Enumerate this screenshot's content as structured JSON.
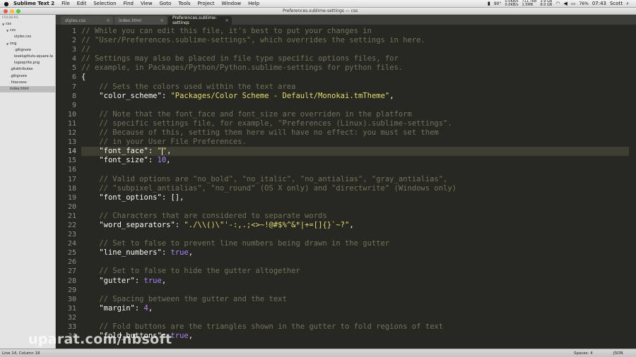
{
  "menubar": {
    "app_name": "Sublime Text 2",
    "items": [
      "File",
      "Edit",
      "Selection",
      "Find",
      "View",
      "Goto",
      "Tools",
      "Project",
      "Window",
      "Help"
    ],
    "tray": {
      "net_up": "0.0KB/s",
      "net_down": "0.0KB/s",
      "mem_a": "711.7KB",
      "mem_b": "1.5MB",
      "disk_a": "3.9 GB",
      "disk_b": "8.0 GB",
      "temp": "90°",
      "battery": "76%",
      "time": "07:43",
      "user": "Scott"
    }
  },
  "window": {
    "title": "Preferences.sublime-settings — css"
  },
  "tabs": [
    {
      "label": "styles.css",
      "active": false
    },
    {
      "label": "index.html",
      "active": false
    },
    {
      "label": "Preferences.sublime-settings",
      "active": true
    }
  ],
  "sidebar": {
    "header": "FOLDERS",
    "items": [
      {
        "label": "css",
        "indent": 0,
        "arrow": "▼",
        "selected": false
      },
      {
        "label": "css",
        "indent": 1,
        "arrow": "▼",
        "selected": false
      },
      {
        "label": "styles.css",
        "indent": 2,
        "arrow": "",
        "selected": false
      },
      {
        "label": "img",
        "indent": 1,
        "arrow": "▼",
        "selected": false
      },
      {
        "label": ".gitignore",
        "indent": 2,
        "arrow": "",
        "selected": false
      },
      {
        "label": "levelupttuts-square-la",
        "indent": 2,
        "arrow": "",
        "selected": false
      },
      {
        "label": "logosprite.png",
        "indent": 2,
        "arrow": "",
        "selected": false
      },
      {
        "label": ".gitattributes",
        "indent": 1,
        "arrow": "",
        "selected": false
      },
      {
        "label": ".gitignore",
        "indent": 1,
        "arrow": "",
        "selected": false
      },
      {
        "label": ".htaccess",
        "indent": 1,
        "arrow": "",
        "selected": false
      },
      {
        "label": "index.html",
        "indent": 1,
        "arrow": "",
        "selected": true
      }
    ]
  },
  "editor": {
    "active_line": 14,
    "lines": [
      {
        "n": "1",
        "text": "// While you can edit this file, it's best to put your changes in"
      },
      {
        "n": "2",
        "text": "// \"User/Preferences.sublime-settings\", which overrides the settings in here."
      },
      {
        "n": "3",
        "text": "//"
      },
      {
        "n": "4",
        "text": "// Settings may also be placed in file type specific options files, for"
      },
      {
        "n": "5",
        "text": "// example, in Packages/Python/Python.sublime-settings for python files."
      },
      {
        "n": "6",
        "text": "{"
      },
      {
        "n": "7",
        "text": "    // Sets the colors used within the text area"
      },
      {
        "n": "8",
        "text": "    \"color_scheme\": \"Packages/Color Scheme - Default/Monokai.tmTheme\","
      },
      {
        "n": "9",
        "text": ""
      },
      {
        "n": "10",
        "text": "    // Note that the font_face and font_size are overriden in the platform"
      },
      {
        "n": "11",
        "text": "    // specific settings file, for example, \"Preferences (Linux).sublime-settings\"."
      },
      {
        "n": "12",
        "text": "    // Because of this, setting them here will have no effect: you must set them"
      },
      {
        "n": "13",
        "text": "    // in your User File Preferences."
      },
      {
        "n": "14",
        "text": "    \"font_face\": \"\","
      },
      {
        "n": "15",
        "text": "    \"font_size\": 10,"
      },
      {
        "n": "16",
        "text": ""
      },
      {
        "n": "17",
        "text": "    // Valid options are \"no_bold\", \"no_italic\", \"no_antialias\", \"gray_antialias\","
      },
      {
        "n": "18",
        "text": "    // \"subpixel_antialias\", \"no_round\" (OS X only) and \"directwrite\" (Windows only)"
      },
      {
        "n": "19",
        "text": "    \"font_options\": [],"
      },
      {
        "n": "20",
        "text": ""
      },
      {
        "n": "21",
        "text": "    // Characters that are considered to separate words"
      },
      {
        "n": "22",
        "text": "    \"word_separators\": \"./\\\\()\\\"'-:,.;<>~!@#$%^&*|+=[]{}`~?\","
      },
      {
        "n": "23",
        "text": ""
      },
      {
        "n": "24",
        "text": "    // Set to false to prevent line numbers being drawn in the gutter"
      },
      {
        "n": "25",
        "text": "    \"line_numbers\": true,"
      },
      {
        "n": "26",
        "text": ""
      },
      {
        "n": "27",
        "text": "    // Set to false to hide the gutter altogether"
      },
      {
        "n": "28",
        "text": "    \"gutter\": true,"
      },
      {
        "n": "29",
        "text": ""
      },
      {
        "n": "30",
        "text": "    // Spacing between the gutter and the text"
      },
      {
        "n": "31",
        "text": "    \"margin\": 4,"
      },
      {
        "n": "32",
        "text": ""
      },
      {
        "n": "33",
        "text": "    // Fold buttons are the triangles shown in the gutter to fold regions of text"
      },
      {
        "n": "34",
        "text": "    \"fold_buttons\": true,"
      }
    ]
  },
  "statusbar": {
    "position": "Line 14, Column 18",
    "spaces": "Spaces: 4",
    "syntax": "JSON"
  },
  "watermark": "uparat.com/nbsoft",
  "colors": {
    "editor_bg": "#272822",
    "comment": "#75715e",
    "string": "#e6db74",
    "number": "#ae81ff",
    "text": "#f8f8f2"
  }
}
